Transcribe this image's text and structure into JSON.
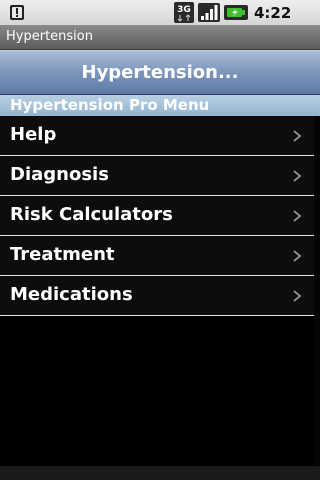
{
  "status_bar": {
    "notification_icon": "alert-notification-icon",
    "network_icon": "3g-network-icon",
    "network_label": "3G",
    "signal_icon": "signal-strength-icon",
    "battery_icon": "battery-charging-icon",
    "time": "4:22 PM"
  },
  "app": {
    "title": "Hypertension"
  },
  "header": {
    "title": "Hypertension..."
  },
  "section": {
    "title": "Hypertension Pro Menu"
  },
  "menu": {
    "items": [
      {
        "label": "Help"
      },
      {
        "label": "Diagnosis"
      },
      {
        "label": "Risk Calculators"
      },
      {
        "label": "Treatment"
      },
      {
        "label": "Medications"
      }
    ]
  },
  "colors": {
    "header_top": "#a9bcd6",
    "header_bottom": "#5f7ba5",
    "section_bg": "#a6c2d8",
    "menu_bg": "#0d0d0d",
    "divider": "#e8e8e8",
    "chevron": "#8c8c8c"
  }
}
